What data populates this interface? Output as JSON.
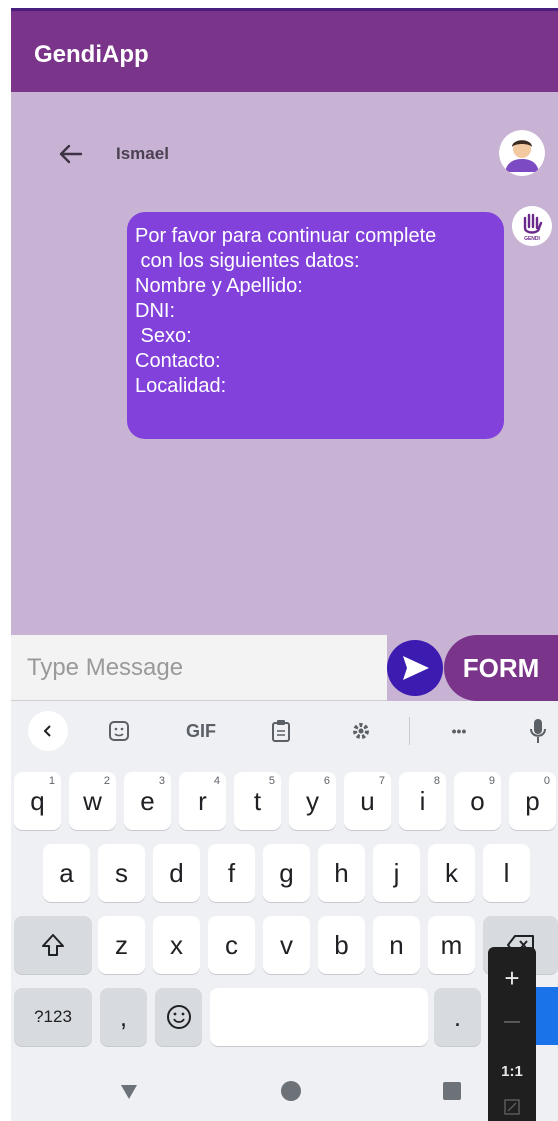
{
  "app": {
    "title": "GendiApp"
  },
  "chat": {
    "contact_name": "Ismael",
    "message_lines": [
      "Por favor para continuar complete",
      " con los siguientes datos:",
      "Nombre y Apellido:",
      "DNI:",
      " Sexo:",
      "Contacto:",
      "Localidad:"
    ],
    "bot_logo_text": "GENDI"
  },
  "composer": {
    "placeholder": "Type Message",
    "form_label": "FORM"
  },
  "keyboard": {
    "toolbar": {
      "gif_label": "GIF",
      "more_label": "•••"
    },
    "row1": [
      {
        "label": "q",
        "hint": "1"
      },
      {
        "label": "w",
        "hint": "2"
      },
      {
        "label": "e",
        "hint": "3"
      },
      {
        "label": "r",
        "hint": "4"
      },
      {
        "label": "t",
        "hint": "5"
      },
      {
        "label": "y",
        "hint": "6"
      },
      {
        "label": "u",
        "hint": "7"
      },
      {
        "label": "i",
        "hint": "8"
      },
      {
        "label": "o",
        "hint": "9"
      },
      {
        "label": "p",
        "hint": "0"
      }
    ],
    "row2": [
      "a",
      "s",
      "d",
      "f",
      "g",
      "h",
      "j",
      "k",
      "l"
    ],
    "row3": [
      "z",
      "x",
      "c",
      "v",
      "b",
      "n",
      "m"
    ],
    "bottom": {
      "symbols_label": "?123",
      "comma_label": ",",
      "period_label": "."
    }
  },
  "zoom": {
    "plus": "+",
    "minus": "—",
    "ratio": "1:1"
  },
  "colors": {
    "appbar": "#7a358a",
    "chat_background": "#c9b3d4",
    "bubble": "#8241db",
    "send_button": "#3b1bb0"
  }
}
